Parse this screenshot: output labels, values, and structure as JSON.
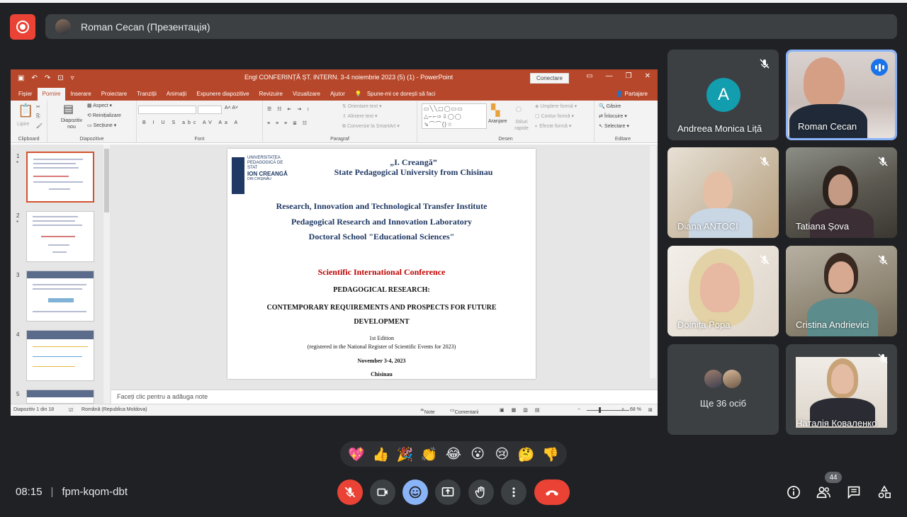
{
  "meet": {
    "presenter_label": "Roman Cecan (Презентація)",
    "time": "08:15",
    "separator": "|",
    "meeting_code": "fpm-kqom-dbt",
    "participant_count": "44",
    "others_label": "Ще 36 осіб",
    "reactions": [
      "💖",
      "👍",
      "🎉",
      "👏",
      "😂",
      "😮",
      "😢",
      "🤔",
      "👎"
    ],
    "colors": {
      "background": "#202124",
      "tile": "#3c4043",
      "hangup": "#ea4335",
      "accent": "#8ab4f8",
      "avatar_A": "#129eaf"
    }
  },
  "participants": [
    {
      "name": "Andreea Monica Liță",
      "initial": "A",
      "muted": true
    },
    {
      "name": "Roman Cecan",
      "muted": false,
      "speaking": true
    },
    {
      "name": "Diana ANTOCI",
      "muted": true
    },
    {
      "name": "Tatiana Șova",
      "muted": true
    },
    {
      "name": "Doinița Popa",
      "muted": true
    },
    {
      "name": "Cristina Andrievici",
      "muted": true
    },
    {
      "name": "Наталія Коваленко",
      "muted": true
    }
  ],
  "ppt": {
    "window_title": "Engl CONFERINȚĂ ȘT. INTERN. 3-4 noiembrie 2023 (5) (1) - PowerPoint",
    "connect_label": "Conectare",
    "tabs": [
      "Fișier",
      "Pornire",
      "Inserare",
      "Proiectare",
      "Tranziții",
      "Animații",
      "Expunere diapozitive",
      "Revizuire",
      "Vizualizare",
      "Ajutor"
    ],
    "tell_me": "Spune-mi ce dorești să faci",
    "share": "Partajare",
    "ribbon": {
      "clipboard": "Clipboard",
      "paste": "Lipire",
      "slides_group": "Diapozitive",
      "new_slide": "Diapozitiv nou",
      "layout": "Aspect",
      "reset": "Reinițializare",
      "section": "Secțiune",
      "font_group": "Font",
      "paragraph_group": "Paragraf",
      "text_direction": "Orientare text",
      "align_text": "Aliniere text",
      "smartart": "Conversie la SmartArt",
      "drawing_group": "Desen",
      "arrange": "Aranjare",
      "quick_styles": "Stiluri rapide",
      "shape_fill": "Umplere formă",
      "shape_outline": "Contur formă",
      "shape_effects": "Efecte formă",
      "editing_group": "Editare",
      "find": "Găsire",
      "replace": "Înlocuire",
      "select": "Selectare"
    },
    "thumbnail_numbers": [
      "1",
      "2",
      "3",
      "4",
      "5"
    ],
    "notes_placeholder": "Faceți clic pentru a adăuga note",
    "status": {
      "slide_of": "Diapozitiv 1 din 18",
      "language": "Română (Republica Moldova)",
      "notes": "Note",
      "comments": "Comentarii",
      "zoom": "68 %"
    },
    "slide": {
      "logo_university": "UNIVERSITATEA PEDAGOGICĂ DE STAT",
      "logo_name": "ION CREANGĂ",
      "logo_city": "DIN CHIȘINĂU",
      "title_quote": "„I. Creangă”",
      "title_university": "State Pedagogical University from Chisinau",
      "institute": "Research, Innovation and Technological Transfer Institute",
      "laboratory": "Pedagogical Research and Innovation Laboratory",
      "school": "Doctoral School \"Educational Sciences\"",
      "conference": "Scientific International Conference",
      "topic_1": "PEDAGOGICAL RESEARCH:",
      "topic_2": "CONTEMPORARY REQUIREMENTS AND PROSPECTS FOR FUTURE",
      "topic_3": "DEVELOPMENT",
      "edition": "1st  Edition",
      "registered": "(registered in the National Register of Scientific Events for 2023)",
      "dates": "November 3-4, 2023",
      "city": "Chisinau"
    }
  }
}
